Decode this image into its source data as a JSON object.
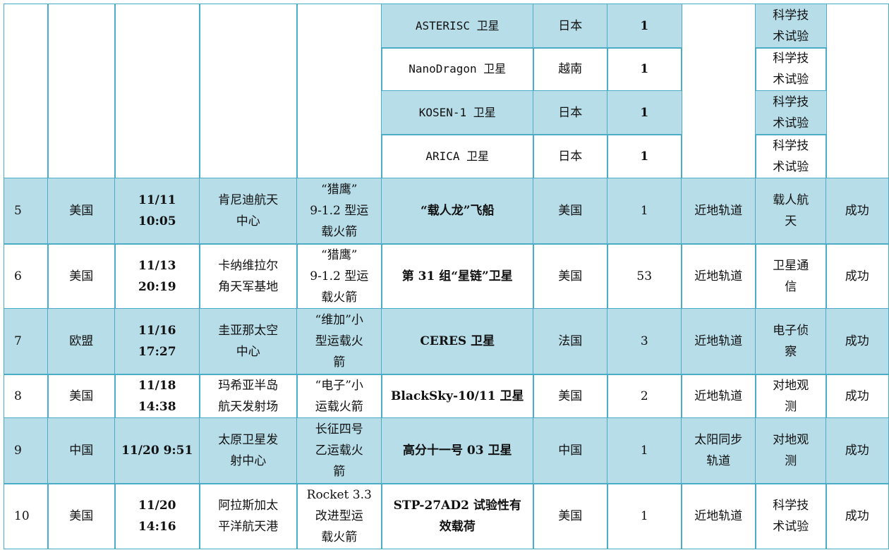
{
  "colors": {
    "border": "#4bacc6",
    "shade": "#b7dde8"
  },
  "top_group": {
    "subrows": [
      {
        "payload": "ASTERISC 卫星",
        "country": "日本",
        "count": "1",
        "purpose": "科学技\n术试验"
      },
      {
        "payload": "NanoDragon 卫星",
        "country": "越南",
        "count": "1",
        "purpose": "科学技\n术试验"
      },
      {
        "payload": "KOSEN-1 卫星",
        "country": "日本",
        "count": "1",
        "purpose": "科学技\n术试验"
      },
      {
        "payload": "ARICA 卫星",
        "country": "日本",
        "count": "1",
        "purpose": "科学技\n术试验"
      }
    ]
  },
  "rows": [
    {
      "no": "5",
      "nation": "美国",
      "time": "11/11 10:05",
      "site": "肯尼迪航天\n中心",
      "rocket": "“猎鹰”\n9-1.2 型运\n载火箭",
      "payload": "“载人龙”飞船",
      "country": "美国",
      "count": "1",
      "orbit": "近地轨道",
      "purpose": "载人航\n天",
      "result": "成功"
    },
    {
      "no": "6",
      "nation": "美国",
      "time": "11/13 20:19",
      "site": "卡纳维拉尔\n角天军基地",
      "rocket": "“猎鹰”\n9-1.2 型运\n载火箭",
      "payload": "第 31 组“星链”卫星",
      "country": "美国",
      "count": "53",
      "orbit": "近地轨道",
      "purpose": "卫星通\n信",
      "result": "成功"
    },
    {
      "no": "7",
      "nation": "欧盟",
      "time": "11/16 17:27",
      "site": "圭亚那太空\n中心",
      "rocket": "“维加”小\n型运载火\n箭",
      "payload": "CERES 卫星",
      "country": "法国",
      "count": "3",
      "orbit": "近地轨道",
      "purpose": "电子侦\n察",
      "result": "成功"
    },
    {
      "no": "8",
      "nation": "美国",
      "time": "11/18 14:38",
      "site": "玛希亚半岛\n航天发射场",
      "rocket": "“电子”小\n运载火箭",
      "payload": "BlackSky-10/11 卫星",
      "country": "美国",
      "count": "2",
      "orbit": "近地轨道",
      "purpose": "对地观\n测",
      "result": "成功"
    },
    {
      "no": "9",
      "nation": "中国",
      "time": "11/20 9:51",
      "site": "太原卫星发\n射中心",
      "rocket": "长征四号\n乙运载火\n箭",
      "payload": "高分十一号 03 卫星",
      "country": "中国",
      "count": "1",
      "orbit": "太阳同步\n轨道",
      "purpose": "对地观\n测",
      "result": "成功"
    },
    {
      "no": "10",
      "nation": "美国",
      "time": "11/20 14:16",
      "site": "阿拉斯加太\n平洋航天港",
      "rocket": "Rocket 3.3\n改进型运\n载火箭",
      "payload": "STP-27AD2 试验性有\n效载荷",
      "country": "美国",
      "count": "1",
      "orbit": "近地轨道",
      "purpose": "科学技\n术试验",
      "result": "成功"
    }
  ]
}
